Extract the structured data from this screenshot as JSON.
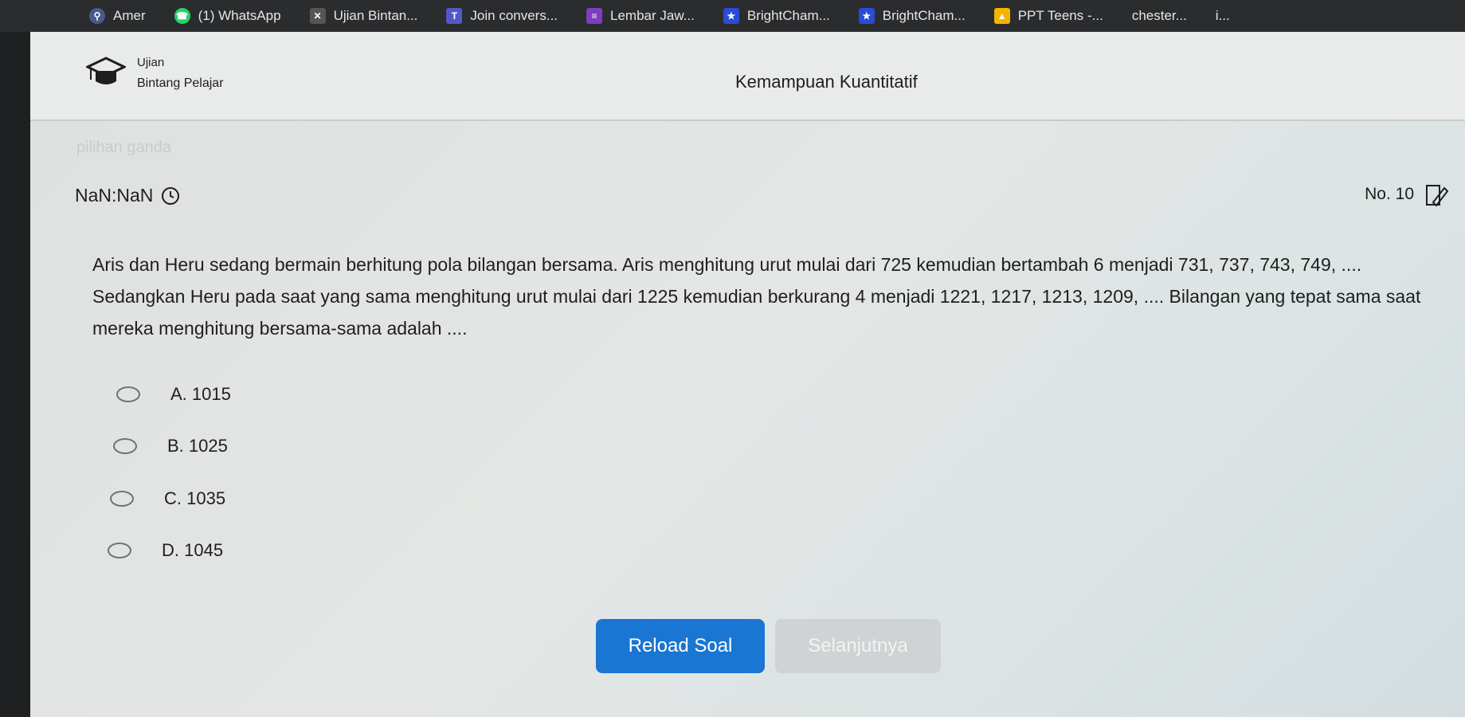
{
  "browser": {
    "tabs": [
      {
        "label": "Amer",
        "icon": "search-icon",
        "color": "#4a5a8a"
      },
      {
        "label": "(1) WhatsApp",
        "icon": "whatsapp-icon",
        "color": "#25d366"
      },
      {
        "label": "Ujian Bintan...",
        "icon": "close-icon",
        "color": "#555555"
      },
      {
        "label": "Join convers...",
        "icon": "teams-icon",
        "color": "#5059c9"
      },
      {
        "label": "Lembar Jaw...",
        "icon": "list-icon",
        "color": "#7b3fbf"
      },
      {
        "label": "BrightCham...",
        "icon": "star-badge-icon",
        "color": "#2a4bd7"
      },
      {
        "label": "BrightCham...",
        "icon": "star-badge-icon",
        "color": "#2a4bd7"
      },
      {
        "label": "PPT Teens -...",
        "icon": "drive-icon",
        "color": "#f4b400"
      },
      {
        "label": "chester...",
        "icon": "",
        "color": "#555555"
      },
      {
        "label": "i...",
        "icon": "",
        "color": "#555555"
      }
    ]
  },
  "header": {
    "brand_top": "Ujian",
    "brand_bottom": "Bintang Pelajar",
    "subject": "Kemampuan Kuantitatif"
  },
  "quiz": {
    "type_label": "pilihan ganda",
    "timer": "NaN:NaN",
    "number_label": "No. 10",
    "question": "Aris dan Heru sedang bermain berhitung pola bilangan bersama. Aris menghitung urut mulai dari 725 kemudian bertambah 6 menjadi 731, 737, 743, 749, .... Sedangkan Heru pada saat yang sama menghitung urut mulai dari 1225 kemudian berkurang 4 menjadi 1221, 1217, 1213, 1209, .... Bilangan yang tepat sama saat mereka menghitung bersama-sama adalah ....",
    "options": [
      "A. 1015",
      "B. 1025",
      "C. 1035",
      "D. 1045"
    ]
  },
  "buttons": {
    "reload": "Reload Soal",
    "next": "Selanjutnya"
  },
  "colors": {
    "primary": "#1976d2",
    "disabled": "#cfd3d4"
  }
}
